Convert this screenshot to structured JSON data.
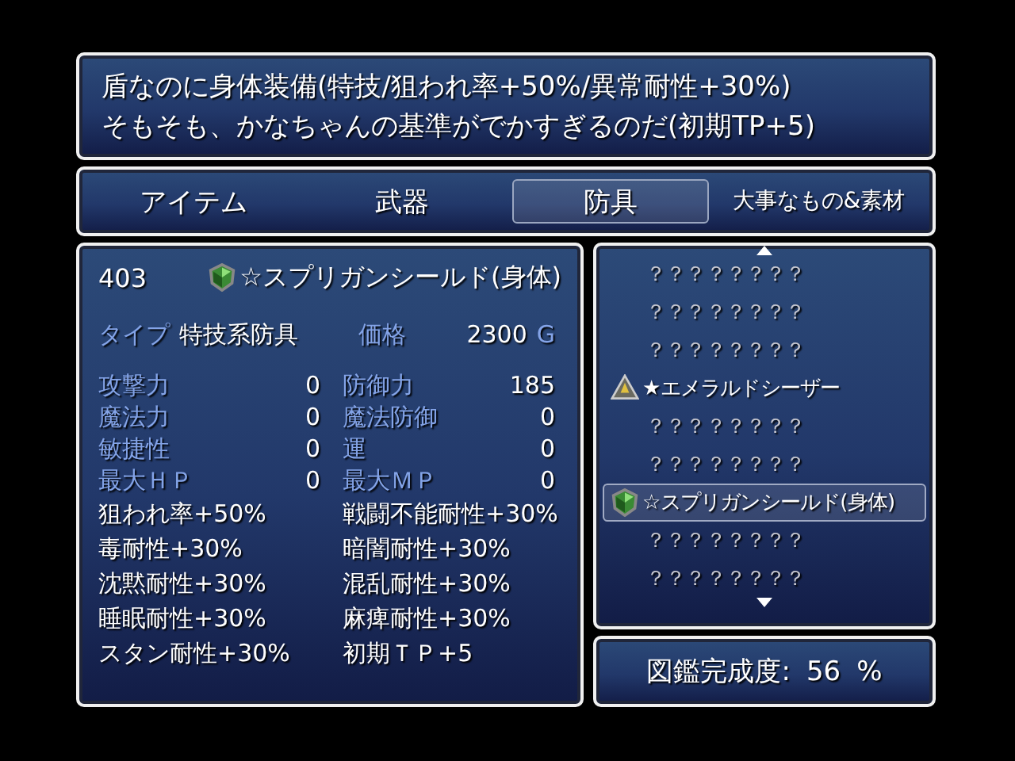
{
  "help": {
    "lines": [
      "盾なのに身体装備(特技/狙われ率+50%/異常耐性+30%)",
      "そもそも、かなちゃんの基準がでかすぎるのだ(初期TP+5)"
    ]
  },
  "tabs": [
    {
      "label": "アイテム",
      "selected": false
    },
    {
      "label": "武器",
      "selected": false
    },
    {
      "label": "防具",
      "selected": true
    },
    {
      "label": "大事なもの&素材",
      "selected": false
    }
  ],
  "detail": {
    "number": "403",
    "kind": "shield",
    "name": "☆スプリガンシールド(身体)",
    "type_label": "タイプ",
    "type_value": "特技系防具",
    "price_label": "価格",
    "price": "2300",
    "currency": "G",
    "stats": [
      {
        "label": "攻撃力",
        "value": "0"
      },
      {
        "label": "防御力",
        "value": "185"
      },
      {
        "label": "魔法力",
        "value": "0"
      },
      {
        "label": "魔法防御",
        "value": "0"
      },
      {
        "label": "敏捷性",
        "value": "0"
      },
      {
        "label": "運",
        "value": "0"
      },
      {
        "label": "最大ＨＰ",
        "value": "0"
      },
      {
        "label": "最大ＭＰ",
        "value": "0"
      }
    ],
    "traits": [
      "狙われ率+50%",
      "戦闘不能耐性+30%",
      "毒耐性+30%",
      "暗闇耐性+30%",
      "沈黙耐性+30%",
      "混乱耐性+30%",
      "睡眠耐性+30%",
      "麻痺耐性+30%",
      "スタン耐性+30%",
      "初期ＴＰ+5"
    ]
  },
  "list": {
    "items": [
      {
        "label": "？？？？？？？？",
        "selected": false
      },
      {
        "label": "？？？？？？？？",
        "selected": false
      },
      {
        "label": "？？？？？？？？",
        "selected": false
      },
      {
        "label": "★エメラルドシーザー",
        "kind": "gem",
        "selected": false
      },
      {
        "label": "？？？？？？？？",
        "selected": false
      },
      {
        "label": "？？？？？？？？",
        "selected": false
      },
      {
        "label": "☆スプリガンシールド(身体)",
        "kind": "shield",
        "selected": true
      },
      {
        "label": "？？？？？？？？",
        "selected": false
      },
      {
        "label": "？？？？？？？？",
        "selected": false
      }
    ]
  },
  "completion": {
    "label": "図鑑完成度:",
    "value": "56",
    "unit": "%"
  }
}
